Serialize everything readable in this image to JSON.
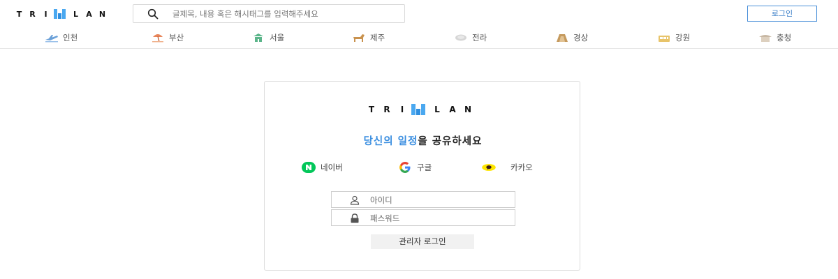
{
  "header": {
    "logo": {
      "left": "TRI",
      "right": "LAN"
    },
    "search": {
      "placeholder": "글제목, 내용 혹은 해시태그를 입력해주세요",
      "value": ""
    },
    "login_label": "로그인"
  },
  "regions": [
    {
      "label": "인천",
      "icon": "airplane-icon",
      "color": "#6aa0d8"
    },
    {
      "label": "부산",
      "icon": "beach-umbrella-icon",
      "color": "#e8855a"
    },
    {
      "label": "서울",
      "icon": "palace-icon",
      "color": "#5bb58a"
    },
    {
      "label": "제주",
      "icon": "horse-icon",
      "color": "#c9924e"
    },
    {
      "label": "전라",
      "icon": "dish-icon",
      "color": "#c8c8c8"
    },
    {
      "label": "경상",
      "icon": "temple-icon",
      "color": "#c59a5e"
    },
    {
      "label": "강원",
      "icon": "cable-car-icon",
      "color": "#e8c46a"
    },
    {
      "label": "충청",
      "icon": "hanok-icon",
      "color": "#c8b8a4"
    }
  ],
  "card": {
    "logo": {
      "left": "TRI",
      "right": "LAN"
    },
    "tagline": {
      "highlight": "당신의 일정",
      "rest": "을 공유하세요"
    },
    "social": [
      {
        "label": "네이버",
        "icon": "naver-icon",
        "color": "#03c75a"
      },
      {
        "label": "구글",
        "icon": "google-icon",
        "color": "#4285f4"
      },
      {
        "label": "카카오",
        "icon": "kakao-icon",
        "color": "#fee500"
      }
    ],
    "id_placeholder": "아이디",
    "password_placeholder": "패스워드",
    "admin_login_label": "관리자 로그인"
  },
  "colors": {
    "accent": "#3a8ee0",
    "logo_blue": "#4aa8f0",
    "border": "#dcdcdc"
  }
}
